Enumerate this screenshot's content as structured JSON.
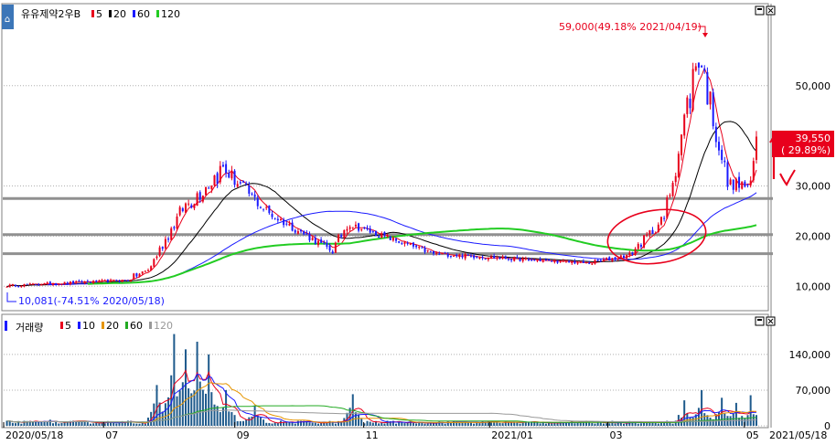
{
  "chart_data": [
    {
      "type": "candlestick",
      "title": "유유제약2우B",
      "legend": [
        {
          "label": "5",
          "color": "#e8001c"
        },
        {
          "label": "20",
          "color": "#000000"
        },
        {
          "label": "60",
          "color": "#1a1aff"
        },
        {
          "label": "120",
          "color": "#22cc22"
        }
      ],
      "ylim": [
        5500,
        66000
      ],
      "y_ticks": [
        "50,000",
        "30,000",
        "20,000",
        "10,000"
      ],
      "y_tick_values": [
        50000,
        30000,
        20000,
        10000
      ],
      "x_ticks": [
        "2020/05/18",
        "07",
        "09",
        "11",
        "2021/01",
        "03",
        "05",
        "2021/05/18"
      ],
      "current_price": {
        "price": "39,550",
        "change": "( 29.89%)"
      },
      "high_annotation": "59,000(49.18% 2021/04/19)",
      "low_annotation": "10,081(-74.51% 2020/05/18)",
      "support_lines": [
        27500,
        20300,
        16500
      ],
      "price_segments": [
        {
          "n": 30,
          "start": 10100,
          "end": 10900,
          "vol": 0.025
        },
        {
          "n": 12,
          "start": 10900,
          "end": 11200,
          "vol": 0.02
        },
        {
          "n": 8,
          "start": 11200,
          "end": 13200,
          "vol": 0.05
        },
        {
          "n": 12,
          "start": 13200,
          "end": 25500,
          "vol": 0.06
        },
        {
          "n": 14,
          "start": 25500,
          "end": 33500,
          "vol": 0.07
        },
        {
          "n": 16,
          "start": 33500,
          "end": 24500,
          "vol": 0.05
        },
        {
          "n": 22,
          "start": 24500,
          "end": 17000,
          "vol": 0.035
        },
        {
          "n": 5,
          "start": 17000,
          "end": 22500,
          "vol": 0.06
        },
        {
          "n": 30,
          "start": 22500,
          "end": 16500,
          "vol": 0.03
        },
        {
          "n": 32,
          "start": 16500,
          "end": 15300,
          "vol": 0.025
        },
        {
          "n": 22,
          "start": 15300,
          "end": 14600,
          "vol": 0.02
        },
        {
          "n": 14,
          "start": 14600,
          "end": 16300,
          "vol": 0.03
        },
        {
          "n": 12,
          "start": 16300,
          "end": 23500,
          "vol": 0.05
        },
        {
          "n": 6,
          "start": 23500,
          "end": 40000,
          "vol": 0.08
        },
        {
          "n": 6,
          "start": 40000,
          "end": 57000,
          "vol": 0.09
        },
        {
          "n": 10,
          "start": 57000,
          "end": 30500,
          "vol": 0.07
        },
        {
          "n": 8,
          "start": 30500,
          "end": 30000,
          "vol": 0.04
        },
        {
          "n": 2,
          "start": 30000,
          "end": 39550,
          "vol": 0.03
        }
      ]
    },
    {
      "type": "bar",
      "title": "거래량",
      "legend": [
        {
          "label": "5",
          "color": "#e8001c"
        },
        {
          "label": "10",
          "color": "#1a1aff"
        },
        {
          "label": "20",
          "color": "#e69500"
        },
        {
          "label": "60",
          "color": "#22aa22"
        },
        {
          "label": "120",
          "color": "#999999"
        }
      ],
      "ylim": [
        0,
        190000
      ],
      "y_ticks": [
        "140,000",
        "70,000",
        "0"
      ],
      "y_tick_values": [
        140000,
        70000,
        0
      ],
      "volume_peaks": [
        {
          "at": 15,
          "v": 12000
        },
        {
          "at": 42,
          "v": 10000
        },
        {
          "at": 52,
          "v": 80000
        },
        {
          "at": 58,
          "v": 180000
        },
        {
          "at": 62,
          "v": 150000
        },
        {
          "at": 66,
          "v": 165000
        },
        {
          "at": 70,
          "v": 140000
        },
        {
          "at": 76,
          "v": 70000
        },
        {
          "at": 86,
          "v": 40000
        },
        {
          "at": 120,
          "v": 62000
        },
        {
          "at": 180,
          "v": 5000
        },
        {
          "at": 235,
          "v": 50000
        },
        {
          "at": 241,
          "v": 70000
        },
        {
          "at": 248,
          "v": 55000
        },
        {
          "at": 253,
          "v": 45000
        },
        {
          "at": 258,
          "v": 60000
        }
      ]
    }
  ]
}
